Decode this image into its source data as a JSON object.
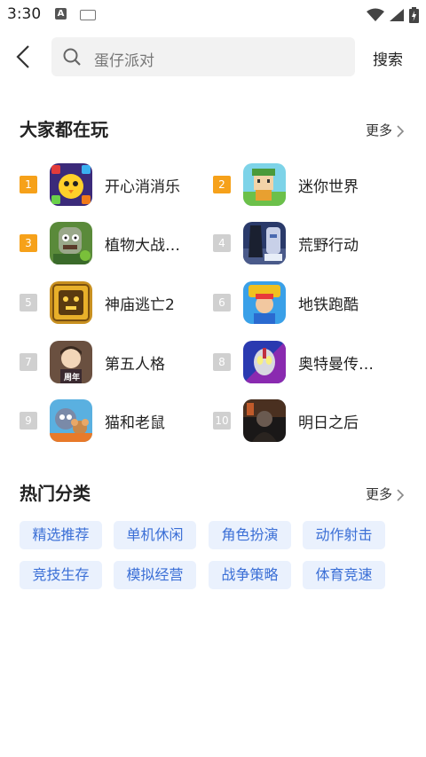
{
  "status": {
    "time": "3:30",
    "a_badge": "A"
  },
  "search": {
    "query": "蛋仔派对",
    "button": "搜索"
  },
  "popular": {
    "title": "大家都在玩",
    "more": "更多",
    "games": [
      {
        "rank": "1",
        "name": "开心消消乐",
        "rank_color": "#f6a11a",
        "icon": "game-icon-happy-elimination"
      },
      {
        "rank": "2",
        "name": "迷你世界",
        "rank_color": "#f6a11a",
        "icon": "game-icon-mini-world"
      },
      {
        "rank": "3",
        "name": "植物大战…",
        "rank_color": "#f6a11a",
        "icon": "game-icon-plants-vs-zombies"
      },
      {
        "rank": "4",
        "name": "荒野行动",
        "rank_color": "#d0d0d0",
        "icon": "game-icon-knives-out"
      },
      {
        "rank": "5",
        "name": "神庙逃亡2",
        "rank_color": "#d0d0d0",
        "icon": "game-icon-temple-run-2"
      },
      {
        "rank": "6",
        "name": "地铁跑酷",
        "rank_color": "#d0d0d0",
        "icon": "game-icon-subway-surfers"
      },
      {
        "rank": "7",
        "name": "第五人格",
        "rank_color": "#d0d0d0",
        "icon": "game-icon-identity-v",
        "icon_badge": "周年"
      },
      {
        "rank": "8",
        "name": "奥特曼传…",
        "rank_color": "#d0d0d0",
        "icon": "game-icon-ultraman"
      },
      {
        "rank": "9",
        "name": "猫和老鼠",
        "rank_color": "#d0d0d0",
        "icon": "game-icon-tom-and-jerry"
      },
      {
        "rank": "10",
        "name": "明日之后",
        "rank_color": "#d0d0d0",
        "icon": "game-icon-lifeafter"
      }
    ]
  },
  "categories": {
    "title": "热门分类",
    "more": "更多",
    "tags": [
      "精选推荐",
      "单机休闲",
      "角色扮演",
      "动作射击",
      "竞技生存",
      "模拟经营",
      "战争策略",
      "体育竞速"
    ]
  }
}
